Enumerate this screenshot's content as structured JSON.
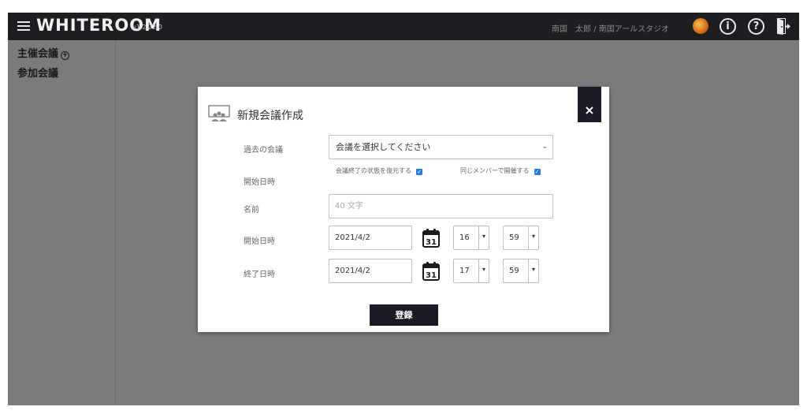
{
  "app": {
    "brand": "WHITEROOM",
    "version": "v1.2.22.0",
    "user": "南国　太郎 / 南国アールスタジオ",
    "icons": {
      "menu": "menu-icon",
      "avatar": "avatar",
      "info": "info-icon",
      "help": "help-icon",
      "logout": "logout-icon"
    },
    "info_glyph": "i",
    "help_glyph": "?"
  },
  "sidebar": {
    "host_label": "主催会議",
    "add_glyph": "+",
    "join_label": "参加会議"
  },
  "modal": {
    "title": "新規会議作成",
    "close": "×",
    "past_label": "過去の会議",
    "past_select": "会議を選択してください",
    "restore_label": "会議終了の状態を復元する",
    "same_members_label": "同じメンバーで開催する",
    "check_glyph": "✓",
    "start_label_top": "開始日時",
    "name_label": "名前",
    "name_placeholder": "40 文字",
    "start_label": "開始日時",
    "start_date": "2021/4/2",
    "start_hour": "16",
    "start_minute": "59",
    "end_label": "終了日時",
    "end_date": "2021/4/2",
    "end_hour": "17",
    "end_minute": "59",
    "calendar_day": "31",
    "submit": "登録"
  }
}
